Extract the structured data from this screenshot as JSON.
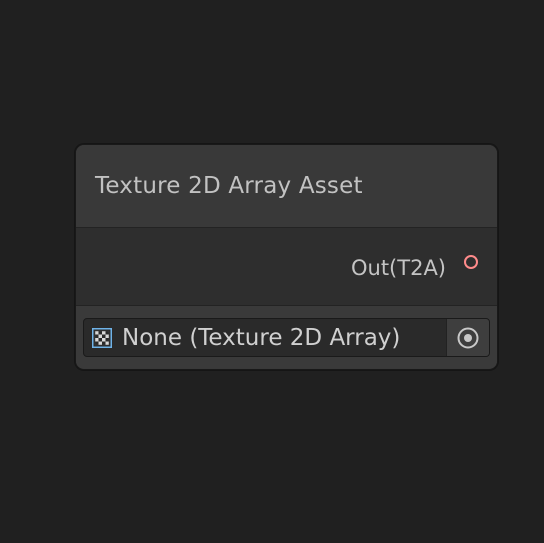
{
  "node": {
    "title": "Texture 2D Array Asset",
    "output_port": {
      "label": "Out(T2A)",
      "color": "#ff8b8b"
    },
    "texture_field": {
      "value": "None (Texture 2D Array)",
      "icon": "checkerboard-texture-icon",
      "picker_icon": "object-picker-icon"
    }
  },
  "colors": {
    "canvas_background": "#202020",
    "node_background": "#393939",
    "port_row_background": "#2e2e2e",
    "field_background": "#2a2a2a",
    "icon_accent": "#6fb3e8"
  }
}
